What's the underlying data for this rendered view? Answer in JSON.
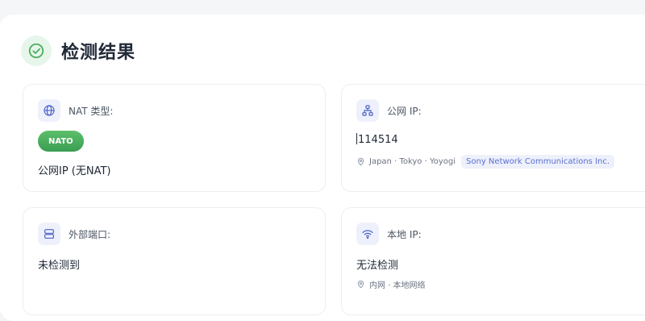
{
  "title": "检测结果",
  "colors": {
    "success_green": "#4caf61",
    "icon_blue": "#4b63c9",
    "isp_tag_text": "#5a6fd0"
  },
  "cards": {
    "nat": {
      "icon": "globe-icon",
      "label": "NAT 类型:",
      "badge": "NATO",
      "value": "公网IP (无NAT)"
    },
    "public_ip": {
      "icon": "network-icon",
      "label": "公网 IP:",
      "value": "114514",
      "location": "Japan · Tokyo · Yoyogi",
      "isp": "Sony Network Communications Inc."
    },
    "external_port": {
      "icon": "server-icon",
      "label": "外部端口:",
      "value": "未检测到"
    },
    "local_ip": {
      "icon": "wifi-icon",
      "label": "本地 IP:",
      "value": "无法检测",
      "location": "内网 · 本地网络"
    }
  }
}
